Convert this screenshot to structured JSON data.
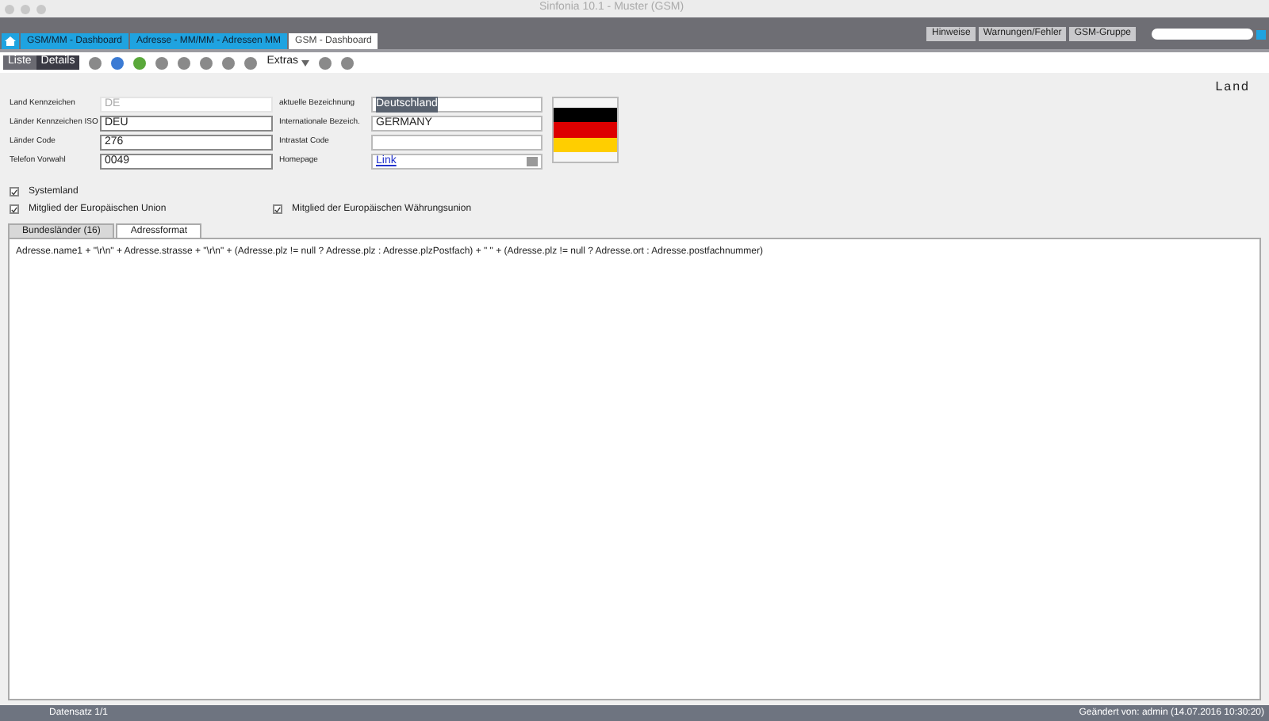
{
  "window": {
    "title": "Sinfonia 10.1 - Muster (GSM)"
  },
  "doc_tabs": [
    {
      "label": "GSM/MM - Dashboard",
      "selected": false
    },
    {
      "label": "Adresse - MM/MM - Adressen MM",
      "selected": false
    },
    {
      "label": "GSM - Dashboard",
      "selected": true
    }
  ],
  "header_right": {
    "items": [
      "Hinweise",
      "Warnungen/Fehler",
      "GSM-Gruppe"
    ]
  },
  "toolbar": {
    "views": [
      {
        "label": "Liste",
        "selected": false
      },
      {
        "label": "Details",
        "selected": true
      }
    ],
    "menu": "Extras"
  },
  "page_title": "Land",
  "fields_left": [
    {
      "label": "Land Kennzeichen",
      "value": "DE",
      "disabled": true
    },
    {
      "label": "Länder Kennzeichen ISO",
      "value": "DEU",
      "disabled": false
    },
    {
      "label": "Länder Code",
      "value": "276",
      "disabled": false
    },
    {
      "label": "Telefon Vorwahl",
      "value": "0049",
      "disabled": false
    }
  ],
  "fields_right": [
    {
      "kind": "selected",
      "label": "aktuelle Bezeichnung",
      "value": "Deutschland"
    },
    {
      "kind": "text",
      "label": "Internationale Bezeich.",
      "value": "GERMANY"
    },
    {
      "kind": "text",
      "label": "Intrastat Code"
    },
    {
      "kind": "link",
      "label": "Homepage",
      "value": "Link"
    }
  ],
  "checkboxes": [
    {
      "label": "Systemland",
      "checked": true
    },
    {
      "label": "Mitglied der Europäischen Union",
      "checked": true
    },
    {
      "label": "Mitglied der Europäischen Währungsunion",
      "checked": true
    }
  ],
  "tabs": [
    {
      "label": "Bundesländer (16)",
      "selected": false
    },
    {
      "label": "Adressformat",
      "selected": true
    }
  ],
  "address_format": "Adresse.name1 + \"\\r\\n\" + Adresse.strasse + \"\\r\\n\" + (Adresse.plz != null ? Adresse.plz : Adresse.plzPostfach) + \" \" + (Adresse.plz != null ? Adresse.ort : Adresse.postfachnummer)",
  "status_bar": {
    "record": "Datensatz 1/1",
    "changed": "Geändert von: admin (14.07.2016 10:30:20)"
  }
}
